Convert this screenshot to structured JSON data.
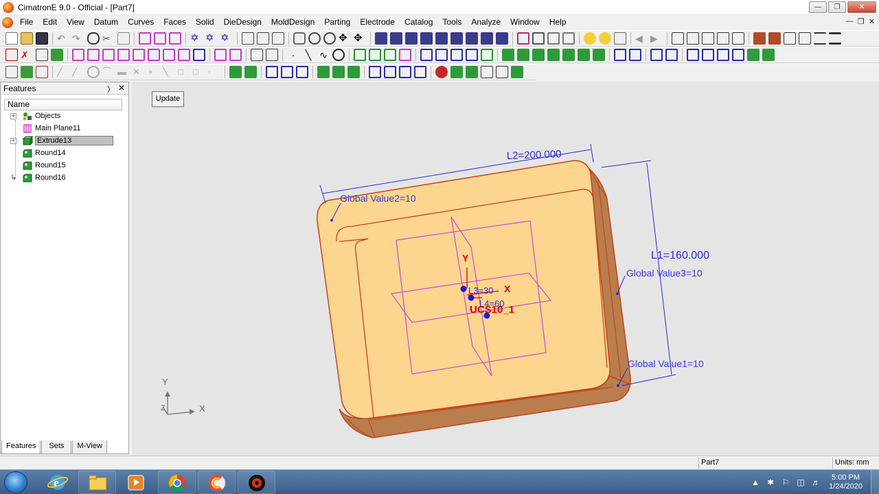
{
  "window": {
    "title": "CimatronE 9.0 - Official - [Part7]"
  },
  "menu": [
    "File",
    "Edit",
    "View",
    "Datum",
    "Curves",
    "Faces",
    "Solid",
    "DieDesign",
    "MoldDesign",
    "Parting",
    "Electrode",
    "Catalog",
    "Tools",
    "Analyze",
    "Window",
    "Help"
  ],
  "panel": {
    "title": "Features",
    "column_header": "Name",
    "tree": [
      {
        "label": "Objects",
        "expand": "+"
      },
      {
        "label": "Main Plane11",
        "expand": ""
      },
      {
        "label": "Extrude13",
        "expand": "+",
        "selected": true
      },
      {
        "label": "Round14",
        "expand": ""
      },
      {
        "label": "Round15",
        "expand": ""
      },
      {
        "label": "Round16",
        "expand": ""
      }
    ],
    "tabs": [
      "Features",
      "Sets",
      "M-View"
    ]
  },
  "viewport": {
    "update_button": "Update",
    "annotations": {
      "l2": "L2=200.000",
      "l1": "L1=160.000",
      "gv2": "Global Value2=10",
      "gv3": "Global Value3=10",
      "gv1": "Global Value1=10",
      "l3": "L3=30",
      "l4": "L4=60",
      "ucs": "UCS10_1",
      "axis_y": "Y",
      "axis_x": "X",
      "triad_y": "Y",
      "triad_x": "X",
      "triad_z": "Z"
    },
    "colors": {
      "solid_top": "#fcd58f",
      "solid_side": "#b97d4e",
      "edge": "#c0461a",
      "dimension": "#2a2ad0",
      "plane": "#c84bd6",
      "ucs": "#e00000"
    }
  },
  "status": {
    "part": "Part7",
    "units": "Units: mm"
  },
  "taskbar": {
    "time": "5:00 PM",
    "date": "1/24/2020",
    "apps": [
      "internet-explorer",
      "file-explorer",
      "media-player",
      "chrome",
      "ccleaner",
      "cimatron"
    ]
  }
}
